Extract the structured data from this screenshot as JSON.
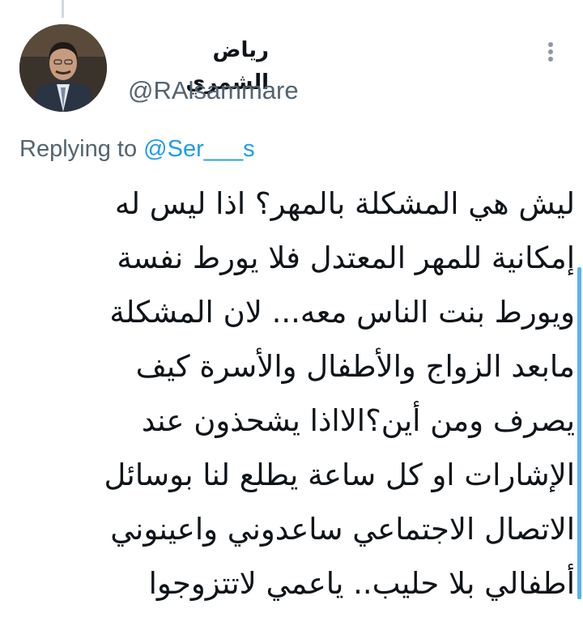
{
  "tweet": {
    "display_name": "رياض الشمري",
    "handle": "@RAlsammare",
    "replying_prefix": "Replying to",
    "replying_to": "@Ser___s",
    "body_lines": [
      "ليش هي المشكلة بالمهر؟ اذا ليس له",
      "إمكانية للمهر المعتدل فلا يورط نفسة",
      "ويورط بنت الناس معه... لان المشكلة",
      "مابعد الزواج والأطفال والأسرة كيف",
      "يصرف ومن أين؟الااذا يشحذون عند",
      "الإشارات او كل ساعة يطلع لنا بوسائل",
      "الاتصال الاجتماعي ساعدوني واعينوني",
      "أطفالي بلا حليب.. ياعمي لاتتزوجوا"
    ]
  },
  "icons": {
    "more": "vertical-ellipsis-icon",
    "avatar": "profile-photo"
  },
  "colors": {
    "text_primary": "#0f1419",
    "text_secondary": "#536471",
    "link_blue": "#1d9bf0",
    "scroll_indicator": "#58b3f2"
  }
}
